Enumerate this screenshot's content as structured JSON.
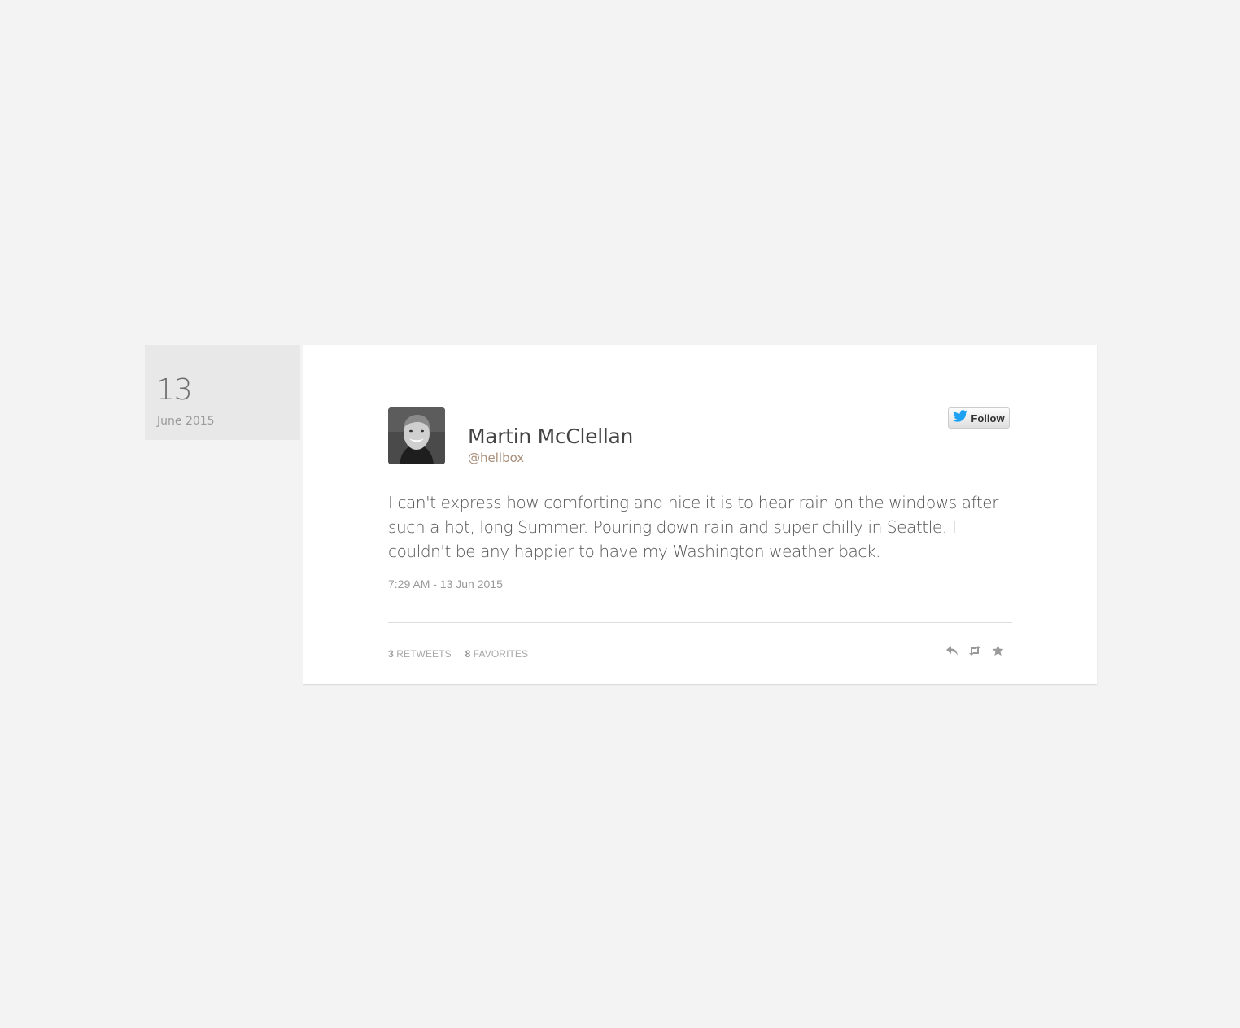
{
  "date": {
    "day": "13",
    "month_year": "June 2015"
  },
  "tweet": {
    "author_name": "Martin McClellan",
    "author_handle": "@hellbox",
    "follow_label": "Follow",
    "text": "I can't express how comforting and nice it is to hear rain on the windows after such a hot, long Summer. Pouring down rain and super chilly in Seattle. I couldn't be any happier to have my Washington weather back.",
    "timestamp": "7:29 AM - 13 Jun 2015",
    "retweets_count": "3",
    "retweets_label": "RETWEETS",
    "favorites_count": "8",
    "favorites_label": "FAVORITES"
  },
  "icons": {
    "follow": "twitter-bird-icon",
    "reply": "reply-icon",
    "retweet": "retweet-icon",
    "favorite": "star-icon"
  },
  "colors": {
    "page_background": "#f3f3f3",
    "date_box": "#e8e8e8",
    "handle": "#a88f7a",
    "twitter_blue": "#1da1f2"
  }
}
